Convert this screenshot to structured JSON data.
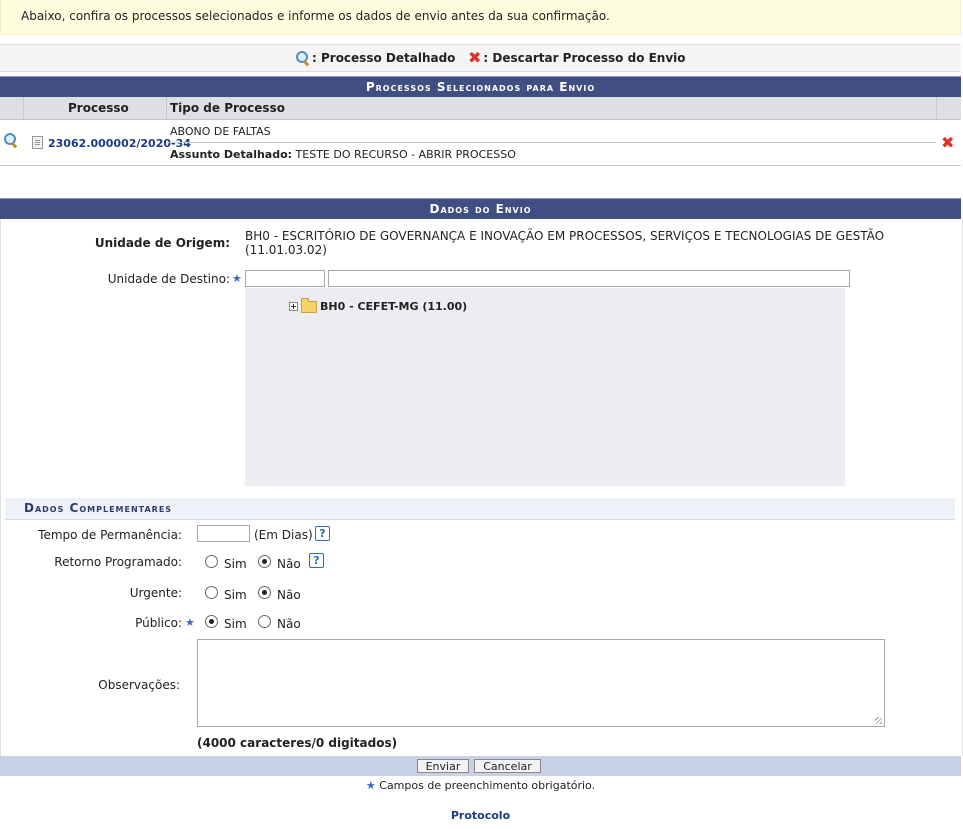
{
  "notice": "Abaixo, confira os processos selecionados e informe os dados de envio antes da sua confirmação.",
  "legend": {
    "detail_label": ": Processo Detalhado",
    "discard_label": ": Descartar Processo do Envio"
  },
  "processes": {
    "title": "Processos Selecionados para Envio",
    "columns": [
      "Processo",
      "Tipo de Processo"
    ],
    "rows": [
      {
        "number": "23062.000002/2020-34",
        "type": "ABONO DE FALTAS",
        "subject_label": "Assunto Detalhado:",
        "subject": "TESTE DO RECURSO - ABRIR PROCESSO"
      }
    ]
  },
  "envio": {
    "title": "Dados do Envio",
    "origem_label": "Unidade de Origem:",
    "origem_value_line1": "BH0 - ESCRITÓRIO DE GOVERNANÇA E INOVAÇÃO EM PROCESSOS, SERVIÇOS E TECNOLOGIAS DE GESTÃO",
    "origem_value_line2": "(11.01.03.02)",
    "destino_label": "Unidade de Destino:",
    "destino_code": "",
    "destino_name": "",
    "tree_root": "BH0 - CEFET-MG (11.00)"
  },
  "complementares": {
    "title": "Dados Complementares",
    "tempo_label": "Tempo de Permanência:",
    "tempo_value": "",
    "tempo_unit": "(Em Dias)",
    "retorno_label": "Retorno Programado:",
    "retorno_value": "Não",
    "urgente_label": "Urgente:",
    "urgente_value": "Não",
    "publico_label": "Público:",
    "publico_value": "Sim",
    "sim_label": "Sim",
    "nao_label": "Não",
    "help_glyph": "?",
    "obs_label": "Observações:",
    "obs_value": "",
    "char_count": "(4000 caracteres/0 digitados)"
  },
  "buttons": {
    "enviar": "Enviar",
    "cancelar": "Cancelar"
  },
  "footer": {
    "required_note": " Campos de preenchimento obrigatório.",
    "module_link": "Protocolo"
  },
  "colors": {
    "header_bar": "#404e82",
    "table_header": "#dedfe3",
    "tree_bg": "#ecedf1",
    "button_bar": "#c8d2e6",
    "link": "#1c3a85",
    "discard": "#e0302b"
  }
}
